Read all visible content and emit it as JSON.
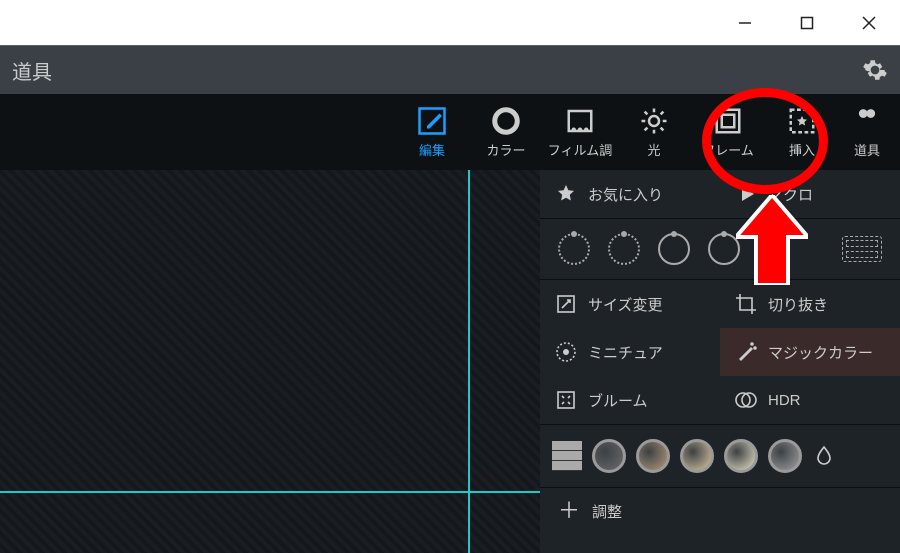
{
  "window": {
    "minimize_tip": "Minimize",
    "maximize_tip": "Maximize",
    "close_tip": "Close"
  },
  "menubar": {
    "title": "道具"
  },
  "tabs": {
    "edit": {
      "label": "編集"
    },
    "color": {
      "label": "カラー"
    },
    "film": {
      "label": "フィルム調"
    },
    "light": {
      "label": "光"
    },
    "frame": {
      "label": "フレーム"
    },
    "insert": {
      "label": "挿入"
    },
    "tools": {
      "label": "道具"
    }
  },
  "side": {
    "fav": "お気に入り",
    "macro": "マクロ",
    "resize": "サイズ変更",
    "crop": "切り抜き",
    "mini": "ミニチュア",
    "magic": "マジックカラー",
    "bloom": "ブルーム",
    "hdr": "HDR",
    "adjust": "調整"
  },
  "palette_colors": [
    "#6b6b6b",
    "#b69a7d",
    "#dcc79f",
    "#e8e1c8",
    "#a0a0a0"
  ]
}
